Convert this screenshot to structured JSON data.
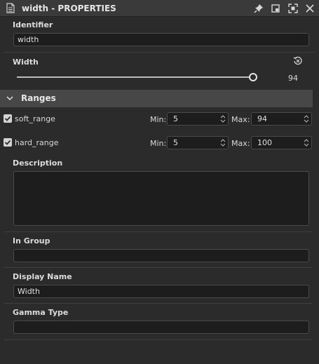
{
  "window": {
    "title": "width - PROPERTIES"
  },
  "identifier": {
    "label": "Identifier",
    "value": "width"
  },
  "width": {
    "label": "Width",
    "value": "94",
    "slider_fraction": 1.0
  },
  "ranges": {
    "label": "Ranges",
    "soft": {
      "label": "soft_range",
      "checked": true,
      "min_label": "Min:",
      "min": "5",
      "max_label": "Max:",
      "max": "94"
    },
    "hard": {
      "label": "hard_range",
      "checked": true,
      "min_label": "Min:",
      "min": "5",
      "max_label": "Max:",
      "max": "100"
    }
  },
  "description": {
    "label": "Description",
    "value": ""
  },
  "in_group": {
    "label": "In Group",
    "value": ""
  },
  "display_name": {
    "label": "Display Name",
    "value": "Width"
  },
  "gamma_type": {
    "label": "Gamma Type",
    "value": ""
  },
  "icons": {
    "document": "document-icon",
    "pin": "pin-icon",
    "restore": "restore-icon",
    "maximize": "maximize-icon",
    "close": "close-icon",
    "reset": "reset-icon",
    "collapse": "chevron-down-icon"
  },
  "colors": {
    "panel": "#2b2b2b",
    "header": "#474747",
    "field": "#1d1d1d"
  }
}
